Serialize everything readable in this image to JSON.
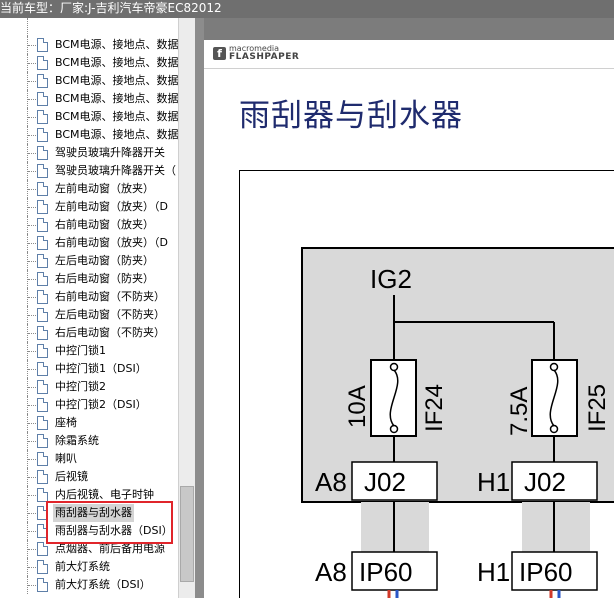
{
  "window": {
    "title": "当前车型：厂家:J-吉利汽车帝豪EC82012"
  },
  "tree": {
    "items": [
      {
        "label": "BCM电源、接地点、数据"
      },
      {
        "label": "BCM电源、接地点、数据"
      },
      {
        "label": "BCM电源、接地点、数据"
      },
      {
        "label": "BCM电源、接地点、数据"
      },
      {
        "label": "BCM电源、接地点、数据"
      },
      {
        "label": "BCM电源、接地点、数据"
      },
      {
        "label": "驾驶员玻璃升降器开关"
      },
      {
        "label": "驾驶员玻璃升降器开关（"
      },
      {
        "label": "左前电动窗（放夹）"
      },
      {
        "label": "左前电动窗（放夹）（D"
      },
      {
        "label": "右前电动窗（放夹）"
      },
      {
        "label": "右前电动窗（放夹）（D"
      },
      {
        "label": "左后电动窗（防夹）"
      },
      {
        "label": "右后电动窗（防夹）"
      },
      {
        "label": "右前电动窗（不防夹）"
      },
      {
        "label": "左后电动窗（不防夹）"
      },
      {
        "label": "右后电动窗（不防夹）"
      },
      {
        "label": "中控门锁1"
      },
      {
        "label": "中控门锁1（DSI）"
      },
      {
        "label": "中控门锁2"
      },
      {
        "label": "中控门锁2（DSI）"
      },
      {
        "label": "座椅"
      },
      {
        "label": "除霜系统"
      },
      {
        "label": "喇叭"
      },
      {
        "label": "后视镜"
      },
      {
        "label": "内后视镜、电子时钟"
      },
      {
        "label": "雨刮器与刮水器"
      },
      {
        "label": "雨刮器与刮水器（DSI）"
      },
      {
        "label": "点烟器、前后备用电源"
      },
      {
        "label": "前大灯系统"
      },
      {
        "label": "前大灯系统（DSI）"
      }
    ],
    "selected_index": 26
  },
  "viewer": {
    "logo_top": "macromedia",
    "logo_bottom": "FLASHPAPER",
    "doc_title": "雨刮器与刮水器"
  },
  "diagram": {
    "power_label": "IG2",
    "fuses": [
      {
        "rating": "10A",
        "name": "IF24"
      },
      {
        "rating": "7.5A",
        "name": "IF25"
      }
    ],
    "connectors": [
      {
        "pin": "A8",
        "name": "J02"
      },
      {
        "pin": "H1",
        "name": "J02"
      },
      {
        "pin": "A8",
        "name": "IP60"
      },
      {
        "pin": "H1",
        "name": "IP60"
      }
    ]
  },
  "colors": {
    "title": "#1f2b6e",
    "highlight": "#e0252b",
    "box_fill": "#d9d9d9"
  }
}
